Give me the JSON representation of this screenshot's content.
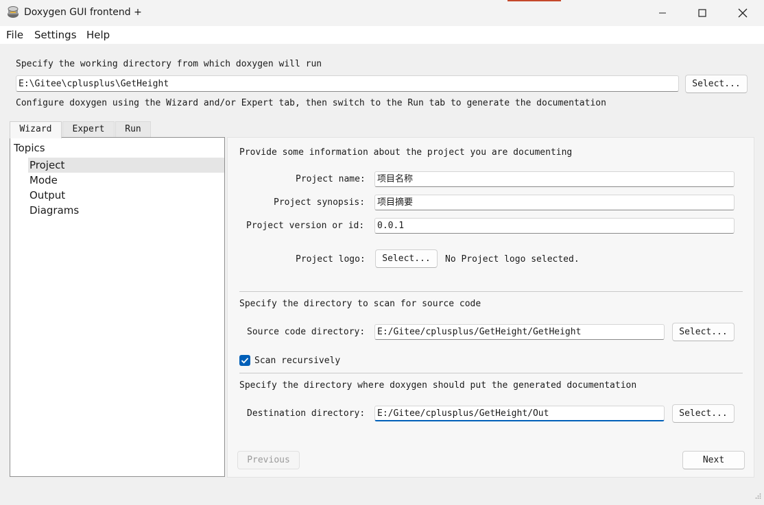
{
  "window": {
    "title": "Doxygen GUI frontend +",
    "controls": {
      "minimize": "minimize-icon",
      "maximize": "maximize-icon",
      "close": "close-icon"
    }
  },
  "menu": [
    "File",
    "Settings",
    "Help"
  ],
  "workdir": {
    "label": "Specify the working directory from which doxygen will run",
    "value": "E:\\Gitee\\cplusplus\\GetHeight",
    "select": "Select...",
    "hint": "Configure doxygen using the Wizard and/or Expert tab, then switch to the Run tab to generate the documentation"
  },
  "tabs": [
    {
      "label": "Wizard",
      "active": true
    },
    {
      "label": "Expert",
      "active": false
    },
    {
      "label": "Run",
      "active": false
    }
  ],
  "topics": {
    "header": "Topics",
    "items": [
      "Project",
      "Mode",
      "Output",
      "Diagrams"
    ],
    "selected": "Project"
  },
  "project": {
    "intro": "Provide some information about the project you are documenting",
    "name_label": "Project name:",
    "name_value": "项目名称",
    "synopsis_label": "Project synopsis:",
    "synopsis_value": "项目摘要",
    "version_label": "Project version or id:",
    "version_value": "0.0.1",
    "logo_label": "Project logo:",
    "logo_button": "Select...",
    "logo_status": "No Project logo selected."
  },
  "source": {
    "intro": "Specify the directory to scan for source code",
    "label": "Source code directory:",
    "value": "E:/Gitee/cplusplus/GetHeight/GetHeight",
    "select": "Select...",
    "recursive_label": "Scan recursively",
    "recursive_checked": true
  },
  "destination": {
    "intro": "Specify the directory where doxygen should put the generated documentation",
    "label": "Destination directory:",
    "value": "E:/Gitee/cplusplus/GetHeight/Out",
    "select": "Select..."
  },
  "nav": {
    "previous": "Previous",
    "next": "Next"
  },
  "colors": {
    "accent": "#005fb8",
    "window_bg": "#f0f0f0"
  }
}
